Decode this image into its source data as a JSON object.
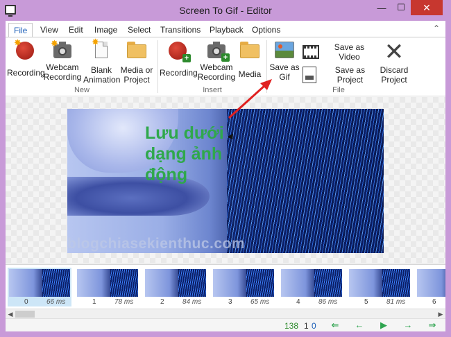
{
  "window": {
    "title": "Screen To Gif - Editor",
    "minimize": "—",
    "maximize": "☐",
    "close": "✕"
  },
  "menu": {
    "tabs": [
      {
        "label": "File"
      },
      {
        "label": "View"
      },
      {
        "label": "Edit"
      },
      {
        "label": "Image"
      },
      {
        "label": "Select"
      },
      {
        "label": "Transitions"
      },
      {
        "label": "Playback"
      },
      {
        "label": "Options"
      }
    ],
    "collapse": "⌃"
  },
  "ribbon": {
    "new_group": {
      "label": "New",
      "recording": "Recording",
      "webcam_recording_1": "Webcam",
      "webcam_recording_2": "Recording",
      "blank_animation_1": "Blank",
      "blank_animation_2": "Animation",
      "media_or_project_1": "Media or",
      "media_or_project_2": "Project"
    },
    "insert_group": {
      "label": "Insert",
      "recording": "Recording",
      "webcam_recording_1": "Webcam",
      "webcam_recording_2": "Recording",
      "media": "Media"
    },
    "file_group": {
      "label": "File",
      "save_as_gif_1": "Save as",
      "save_as_gif_2": "Gif",
      "save_as_video": "Save as Video",
      "save_as_project": "Save as Project",
      "discard_project_1": "Discard",
      "discard_project_2": "Project"
    }
  },
  "canvas": {
    "annotation_line1": "Lưu dưới",
    "annotation_line2": "dạng ảnh",
    "annotation_line3": "động",
    "watermark": "blogchiasekienthuc.com",
    "annotation_color": "#2fa84b",
    "arrow_color": "#e02020"
  },
  "frames": [
    {
      "index": "0",
      "delay": "66 ms"
    },
    {
      "index": "1",
      "delay": "78 ms"
    },
    {
      "index": "2",
      "delay": "84 ms"
    },
    {
      "index": "3",
      "delay": "65 ms"
    },
    {
      "index": "4",
      "delay": "86 ms"
    },
    {
      "index": "5",
      "delay": "81 ms"
    },
    {
      "index": "6",
      "delay": ""
    }
  ],
  "status": {
    "frame_count": "138",
    "selected_count": "1",
    "current_frame": "0",
    "nav_first": "⇐",
    "nav_prev": "←",
    "nav_play": "▶",
    "nav_next": "→",
    "nav_last": "⇒"
  }
}
